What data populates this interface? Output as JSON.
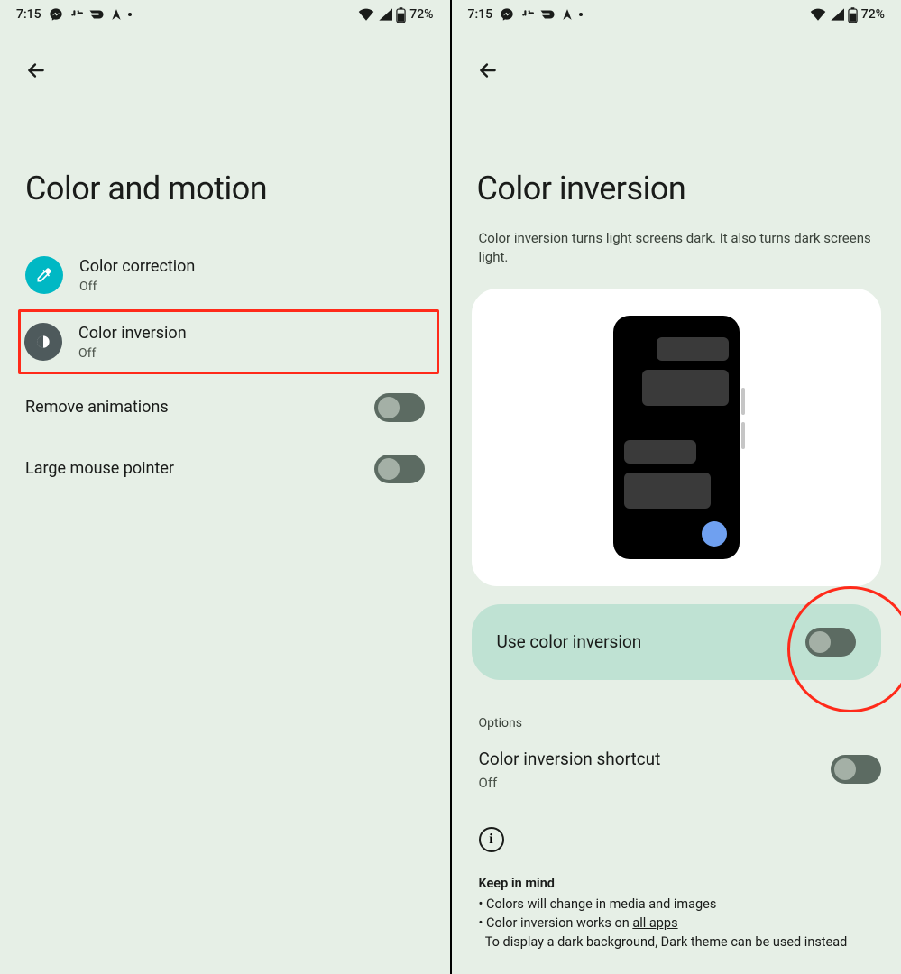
{
  "status": {
    "time": "7:15",
    "battery": "72%"
  },
  "left": {
    "title": "Color and motion",
    "items": {
      "correction": {
        "title": "Color correction",
        "sub": "Off"
      },
      "inversion": {
        "title": "Color inversion",
        "sub": "Off"
      },
      "remove_anim": {
        "title": "Remove animations"
      },
      "large_pointer": {
        "title": "Large mouse pointer"
      }
    }
  },
  "right": {
    "title": "Color inversion",
    "description": "Color inversion turns light screens dark. It also turns dark screens light.",
    "use_label": "Use color inversion",
    "options_label": "Options",
    "shortcut": {
      "title": "Color inversion shortcut",
      "sub": "Off"
    },
    "keep": {
      "heading": "Keep in mind",
      "line1": "Colors will change in media and images",
      "line2_pre": "Color inversion works on ",
      "line2_link": "all apps",
      "line3": "To display a dark background, Dark theme can be used instead"
    }
  }
}
